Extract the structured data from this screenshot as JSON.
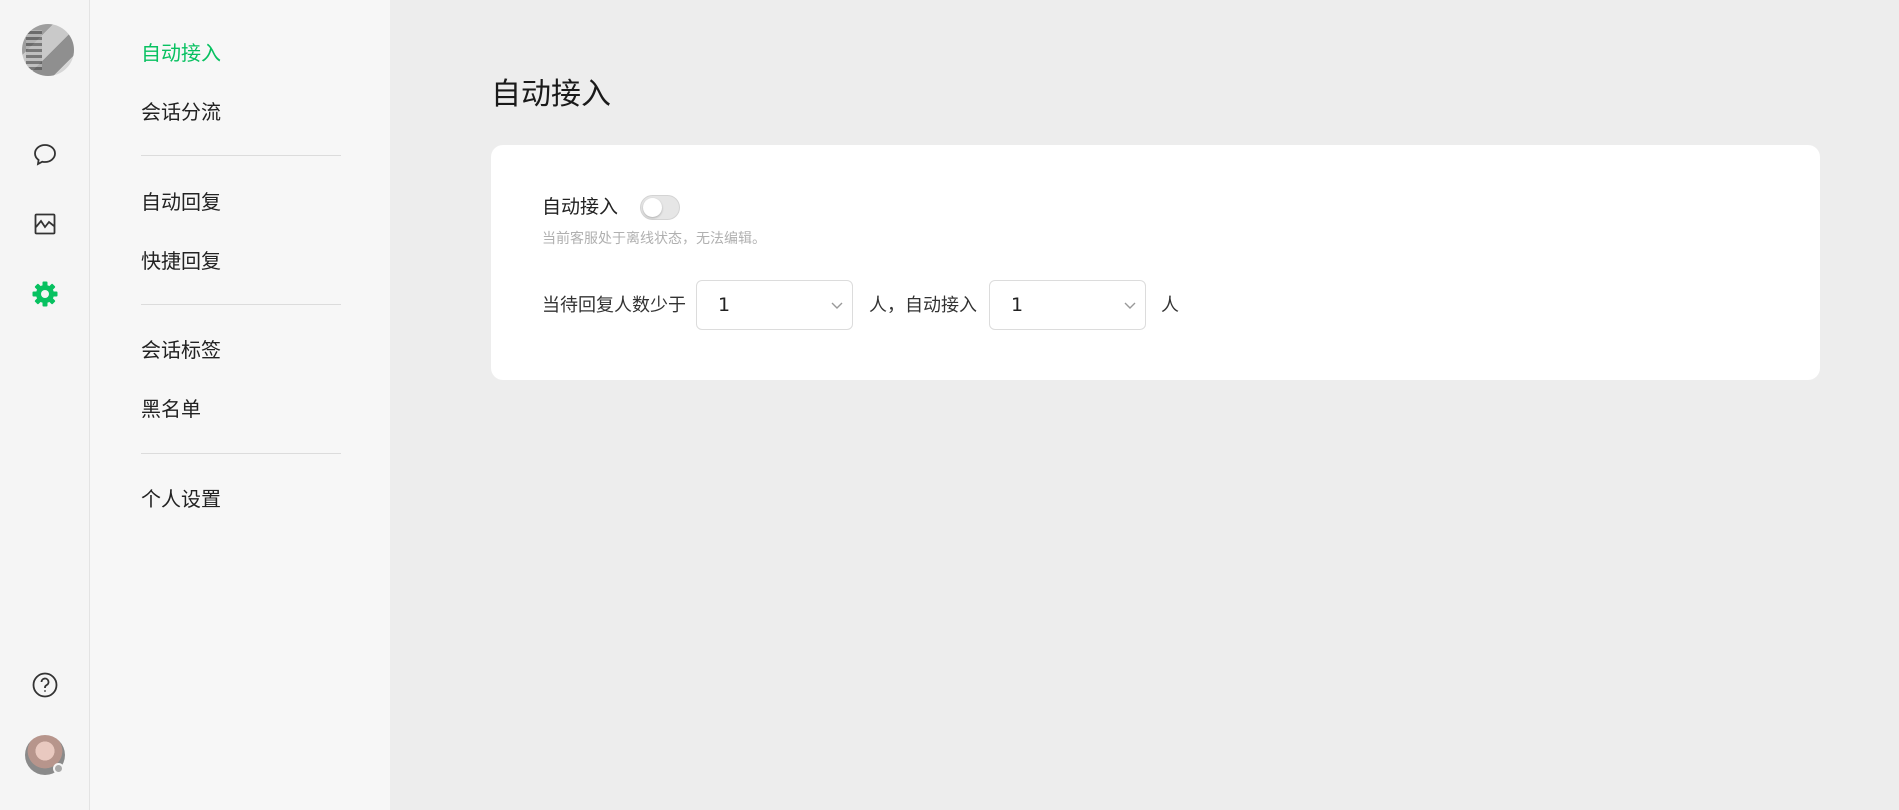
{
  "menu": {
    "items": [
      {
        "label": "自动接入",
        "active": true
      },
      {
        "label": "会话分流"
      },
      {
        "label": "自动回复"
      },
      {
        "label": "快捷回复"
      },
      {
        "label": "会话标签"
      },
      {
        "label": "黑名单"
      },
      {
        "label": "个人设置"
      }
    ]
  },
  "rail": {
    "icons": [
      "chat-bubble-icon",
      "stats-chart-icon",
      "settings-gear-icon",
      "help-icon"
    ],
    "active_color": "#07c160"
  },
  "main": {
    "title": "自动接入",
    "auto_access": {
      "label": "自动接入",
      "enabled": false,
      "hint": "当前客服处于离线状态，无法编辑。"
    },
    "rule": {
      "prefix": "当待回复人数少于",
      "threshold_value": "1",
      "middle": "人，自动接入",
      "access_value": "1",
      "suffix": "人"
    }
  },
  "colors": {
    "accent": "#07c160",
    "background": "#ededed",
    "card": "#ffffff"
  }
}
